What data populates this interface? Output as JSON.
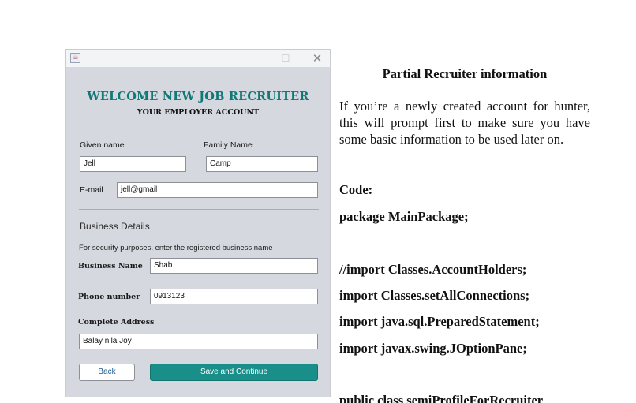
{
  "window": {
    "icon": "java-cup-icon",
    "minimize_glyph": "—",
    "maximize_glyph": "☐",
    "close_glyph": "✕"
  },
  "form": {
    "title": "WELCOME NEW JOB RECRUITER",
    "subtitle": "YOUR EMPLOYER ACCOUNT",
    "given_name_label": "Given name",
    "given_name_value": "Jell",
    "family_name_label": "Family Name",
    "family_name_value": "Camp",
    "email_label": "E-mail",
    "email_value": "jell@gmail",
    "business_section": "Business Details",
    "business_note": "For security purposes, enter the registered business name",
    "business_name_label": "Business Name",
    "business_name_value": "Shab",
    "phone_label": "Phone number",
    "phone_value": "0913123",
    "address_label": "Complete Address",
    "address_value": "Balay nila Joy",
    "back_label": "Back",
    "save_label": "Save and Continue"
  },
  "document": {
    "title": "Partial Recruiter information",
    "paragraph": "If you’re a newly created account for hunter, this will prompt first to make sure you have some basic information to be used later on.",
    "code_heading": "Code:",
    "code_lines": [
      "package MainPackage;",
      "//import Classes.AccountHolders;",
      "import Classes.setAllConnections;",
      "import java.sql.PreparedStatement;",
      "import javax.swing.JOptionPane;",
      "public class semiProfileForRecruiter"
    ]
  },
  "colors": {
    "accent": "#117878",
    "save_button": "#1a8f8a",
    "window_bg": "#d5d8de"
  }
}
